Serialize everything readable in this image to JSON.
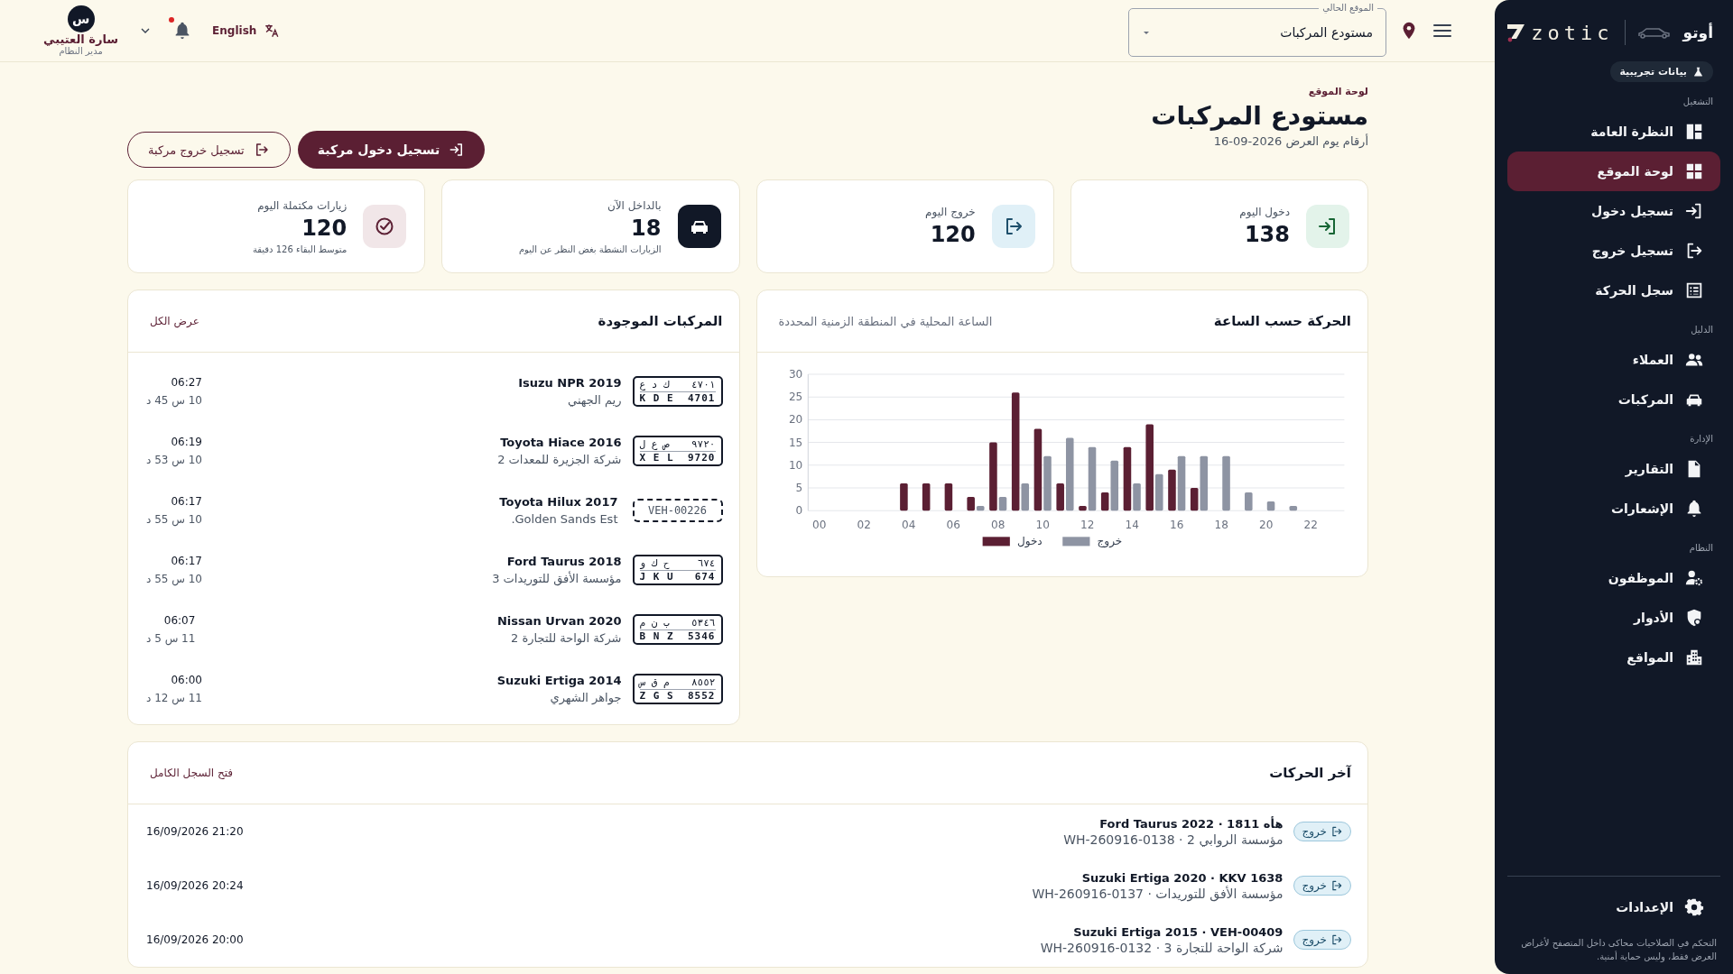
{
  "sidebar": {
    "brand": {
      "app_name": "أوتو",
      "logo_text": "zotic"
    },
    "demo_badge": "بيانات تجريبية",
    "sections": [
      {
        "title": "التشغيل",
        "items": [
          {
            "label": "النظرة العامة",
            "selected": false
          },
          {
            "label": "لوحة الموقع",
            "selected": true
          },
          {
            "label": "تسجيل دخول",
            "selected": false
          },
          {
            "label": "تسجيل خروج",
            "selected": false
          },
          {
            "label": "سجل الحركة",
            "selected": false
          }
        ]
      },
      {
        "title": "الدليل",
        "items": [
          {
            "label": "العملاء",
            "selected": false
          },
          {
            "label": "المركبات",
            "selected": false
          }
        ]
      },
      {
        "title": "الإدارة",
        "items": [
          {
            "label": "التقارير",
            "selected": false
          },
          {
            "label": "الإشعارات",
            "selected": false
          }
        ]
      },
      {
        "title": "النظام",
        "items": [
          {
            "label": "الموظفون",
            "selected": false
          },
          {
            "label": "الأدوار",
            "selected": false
          },
          {
            "label": "المواقع",
            "selected": false
          }
        ]
      }
    ],
    "settings": "الإعدادات",
    "footnote": "التحكم في الصلاحيات محاكى داخل المتصفح لأغراض العرض فقط، وليس حماية أمنية."
  },
  "header": {
    "location": {
      "label": "الموقع الحالي",
      "value": "مستودع المركبات"
    },
    "language": "English",
    "notifications": {
      "unread": true
    },
    "user": {
      "initial": "س",
      "name": "سارة العتيبي",
      "role": "مدير النظام"
    }
  },
  "page": {
    "breadcrumb": "لوحة الموقع",
    "title": "مستودع المركبات",
    "subtitle": {
      "label": "أرقام يوم العرض",
      "date": "16-09-2026"
    },
    "actions": [
      {
        "kind": "primary",
        "label": "تسجيل دخول مركبة"
      },
      {
        "kind": "secondary",
        "label": "تسجيل خروج مركبة"
      }
    ]
  },
  "stats": [
    {
      "kind": "entry",
      "label": "دخول اليوم",
      "value": "138"
    },
    {
      "kind": "exit",
      "label": "خروج اليوم",
      "value": "120"
    },
    {
      "kind": "inside",
      "label": "بالداخل الآن",
      "value": "18",
      "note": "الزيارات النشطة بغض النظر عن اليوم"
    },
    {
      "kind": "completed",
      "label": "زيارات مكتملة اليوم",
      "value": "120",
      "note": "متوسط البقاء 126 دقيقة"
    }
  ],
  "chart_panel": {
    "title": "الحركة حسب الساعة",
    "subtitle": "الساعة المحلية في المنطقة الزمنية المحددة",
    "chart_data": {
      "type": "bar",
      "x": [
        0,
        1,
        2,
        3,
        4,
        5,
        6,
        7,
        8,
        9,
        10,
        11,
        12,
        13,
        14,
        15,
        16,
        17,
        18,
        19,
        20,
        21,
        22,
        23
      ],
      "xlim": [
        -0.5,
        23.5
      ],
      "xticks": [
        {
          "value": 0,
          "label": "00"
        },
        {
          "value": 2,
          "label": "02"
        },
        {
          "value": 4,
          "label": "04"
        },
        {
          "value": 6,
          "label": "06"
        },
        {
          "value": 8,
          "label": "08"
        },
        {
          "value": 10,
          "label": "10"
        },
        {
          "value": 12,
          "label": "12"
        },
        {
          "value": 14,
          "label": "14"
        },
        {
          "value": 16,
          "label": "16"
        },
        {
          "value": 18,
          "label": "18"
        },
        {
          "value": 20,
          "label": "20"
        },
        {
          "value": 22,
          "label": "22"
        }
      ],
      "yticks": [
        0,
        5,
        10,
        15,
        20,
        25,
        30
      ],
      "ylim": [
        0,
        30
      ],
      "grid": true,
      "legend": "bottom",
      "series": [
        {
          "name": "دخول",
          "color": "#5b1f33",
          "values": [
            0,
            0,
            0,
            0,
            6,
            6,
            6,
            3,
            15,
            26,
            18,
            6,
            1,
            4,
            14,
            19,
            9,
            5,
            0,
            0,
            0,
            0,
            0,
            0
          ]
        },
        {
          "name": "خروج",
          "color": "#8e94a3",
          "values": [
            0,
            0,
            0,
            0,
            0,
            0,
            0,
            1,
            3,
            6,
            12,
            16,
            14,
            11,
            6,
            8,
            12,
            12,
            12,
            4,
            2,
            1,
            0,
            0
          ]
        }
      ]
    }
  },
  "vehicles_panel": {
    "title": "المركبات الموجودة",
    "link": "عرض الكل",
    "rows": [
      {
        "plate": {
          "kind": "standard",
          "ar_letters": "ك د ع",
          "ar_digits": "٤٧٠١",
          "letters": "K D E",
          "digits": "4701"
        },
        "title": "Isuzu NPR 2019",
        "owner": "ريم الجهني",
        "time": "06:27",
        "duration": "10 س 45 د"
      },
      {
        "plate": {
          "kind": "standard",
          "ar_letters": "ص ع ل",
          "ar_digits": "٩٧٢٠",
          "letters": "X E L",
          "digits": "9720"
        },
        "title": "Toyota Hiace 2016",
        "owner": "شركة الجزيرة للمعدات 2",
        "time": "06:19",
        "duration": "10 س 53 د"
      },
      {
        "plate": {
          "kind": "temporary",
          "number": "VEH-00226"
        },
        "title": "Toyota Hilux 2017",
        "owner": "Golden Sands Est.",
        "time": "06:17",
        "duration": "10 س 55 د"
      },
      {
        "plate": {
          "kind": "standard",
          "ar_letters": "ح ك و",
          "ar_digits": "٦٧٤",
          "letters": "J K U",
          "digits": "674"
        },
        "title": "Ford Taurus 2018",
        "owner": "مؤسسة الأفق للتوريدات 3",
        "time": "06:17",
        "duration": "10 س 55 د"
      },
      {
        "plate": {
          "kind": "standard",
          "ar_letters": "ب ن م",
          "ar_digits": "٥٣٤٦",
          "letters": "B N Z",
          "digits": "5346"
        },
        "title": "Nissan Urvan 2020",
        "owner": "شركة الواحة للتجارة 2",
        "time": "06:07",
        "duration": "11 س 5 د"
      },
      {
        "plate": {
          "kind": "standard",
          "ar_letters": "م ق س",
          "ar_digits": "٨٥٥٢",
          "letters": "Z G S",
          "digits": "8552"
        },
        "title": "Suzuki Ertiga 2014",
        "owner": "جواهر الشهري",
        "time": "06:00",
        "duration": "11 س 12 د"
      }
    ]
  },
  "recent_panel": {
    "title": "آخر الحركات",
    "link": "فتح السجل الكامل",
    "rows": [
      {
        "kind": "exit",
        "badge": "خروج",
        "title": "Ford Taurus 2022 · 1811 هأه",
        "subtitle": "مؤسسة الروابي 2 · WH-260916-0138",
        "time": "16/09/2026 21:20"
      },
      {
        "kind": "exit",
        "badge": "خروج",
        "title": "Suzuki Ertiga 2020 · KKV 1638",
        "subtitle": "مؤسسة الأفق للتوريدات · WH-260916-0137",
        "time": "16/09/2026 20:24"
      },
      {
        "kind": "exit",
        "badge": "خروج",
        "title": "Suzuki Ertiga 2015 · VEH-00409",
        "subtitle": "شركة الواحة للتجارة 3 · WH-260916-0132",
        "time": "16/09/2026 20:00"
      }
    ]
  }
}
